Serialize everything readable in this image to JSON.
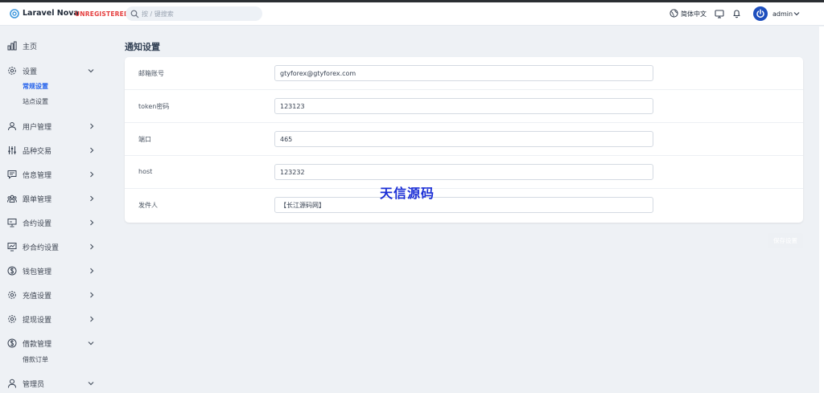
{
  "header": {
    "brand": "Laravel Nova",
    "badge": "UNREGISTERED",
    "search_placeholder": "按 / 键搜索",
    "language": "简体中文",
    "user_name": "admin"
  },
  "sidebar": {
    "items": [
      {
        "label": "主页",
        "icon": "chart-bar-icon"
      },
      {
        "label": "设置",
        "icon": "gear-icon",
        "expanded": true,
        "children": [
          {
            "label": "常规设置",
            "active": true
          },
          {
            "label": "站点设置",
            "active": false
          }
        ]
      },
      {
        "label": "用户管理",
        "icon": "users-icon"
      },
      {
        "label": "品种交易",
        "icon": "sliders-icon"
      },
      {
        "label": "信息管理",
        "icon": "message-icon"
      },
      {
        "label": "跟单管理",
        "icon": "user-group-icon"
      },
      {
        "label": "合约设置",
        "icon": "presentation-icon"
      },
      {
        "label": "秒合约设置",
        "icon": "trend-chart-icon"
      },
      {
        "label": "钱包管理",
        "icon": "dollar-circle-icon"
      },
      {
        "label": "充值设置",
        "icon": "gear-icon"
      },
      {
        "label": "提现设置",
        "icon": "gear-icon"
      },
      {
        "label": "借款管理",
        "icon": "dollar-circle-icon",
        "expanded": true,
        "children": [
          {
            "label": "借款订单",
            "active": false
          }
        ]
      },
      {
        "label": "管理员",
        "icon": "user-icon",
        "expanded": true
      }
    ]
  },
  "main": {
    "title": "通知设置",
    "fields": [
      {
        "label": "邮箱账号",
        "value": "gtyforex@gtyforex.com"
      },
      {
        "label": "token密码",
        "value": "123123"
      },
      {
        "label": "端口",
        "value": "465"
      },
      {
        "label": "host",
        "value": "123232"
      },
      {
        "label": "发件人",
        "value": "【长江源码网】"
      }
    ],
    "save_label": "保存设置"
  },
  "watermark": "天信源码",
  "colors": {
    "accent": "#2563eb",
    "badge": "#e53e3e",
    "avatar": "#1e4fbe",
    "watermark": "#1b2fd6"
  }
}
